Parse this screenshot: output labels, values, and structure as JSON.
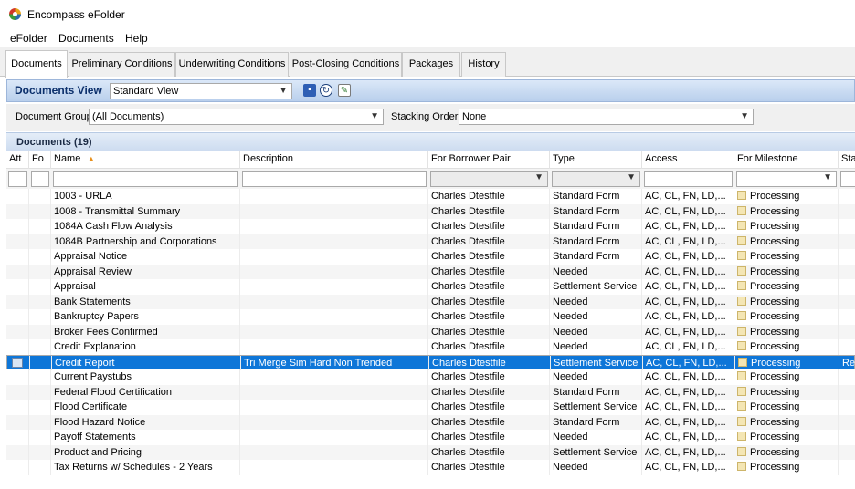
{
  "window": {
    "title": "Encompass eFolder"
  },
  "menu": [
    "eFolder",
    "Documents",
    "Help"
  ],
  "tabs": [
    "Documents",
    "Preliminary Conditions",
    "Underwriting Conditions",
    "Post-Closing Conditions",
    "Packages",
    "History"
  ],
  "documents_view": {
    "label": "Documents View",
    "view_value": "Standard View"
  },
  "filters": {
    "group_label": "Document Group",
    "group_value": "(All Documents)",
    "stacking_label": "Stacking Order",
    "stacking_value": "None"
  },
  "docs_header": "Documents (19)",
  "columns": [
    "Att",
    "Fo",
    "Name",
    "Description",
    "For Borrower Pair",
    "Type",
    "Access",
    "For Milestone",
    "Sta"
  ],
  "sort_indicator": "▲",
  "rows": [
    {
      "name": "1003 - URLA",
      "description": "",
      "borrower": "Charles Dtestfile",
      "type": "Standard Form",
      "access": "AC, CL, FN, LD,...",
      "milestone": "Processing",
      "status": ""
    },
    {
      "name": "1008 - Transmittal Summary",
      "description": "",
      "borrower": "Charles Dtestfile",
      "type": "Standard Form",
      "access": "AC, CL, FN, LD,...",
      "milestone": "Processing",
      "status": ""
    },
    {
      "name": "1084A Cash Flow Analysis",
      "description": "",
      "borrower": "Charles Dtestfile",
      "type": "Standard Form",
      "access": "AC, CL, FN, LD,...",
      "milestone": "Processing",
      "status": ""
    },
    {
      "name": "1084B Partnership and Corporations",
      "description": "",
      "borrower": "Charles Dtestfile",
      "type": "Standard Form",
      "access": "AC, CL, FN, LD,...",
      "milestone": "Processing",
      "status": ""
    },
    {
      "name": "Appraisal Notice",
      "description": "",
      "borrower": "Charles Dtestfile",
      "type": "Standard Form",
      "access": "AC, CL, FN, LD,...",
      "milestone": "Processing",
      "status": ""
    },
    {
      "name": "Appraisal Review",
      "description": "",
      "borrower": "Charles Dtestfile",
      "type": "Needed",
      "access": "AC, CL, FN, LD,...",
      "milestone": "Processing",
      "status": ""
    },
    {
      "name": "Appraisal",
      "description": "",
      "borrower": "Charles Dtestfile",
      "type": "Settlement Service",
      "access": "AC, CL, FN, LD,...",
      "milestone": "Processing",
      "status": ""
    },
    {
      "name": "Bank Statements",
      "description": "",
      "borrower": "Charles Dtestfile",
      "type": "Needed",
      "access": "AC, CL, FN, LD,...",
      "milestone": "Processing",
      "status": ""
    },
    {
      "name": "Bankruptcy Papers",
      "description": "",
      "borrower": "Charles Dtestfile",
      "type": "Needed",
      "access": "AC, CL, FN, LD,...",
      "milestone": "Processing",
      "status": ""
    },
    {
      "name": "Broker Fees Confirmed",
      "description": "",
      "borrower": "Charles Dtestfile",
      "type": "Needed",
      "access": "AC, CL, FN, LD,...",
      "milestone": "Processing",
      "status": ""
    },
    {
      "name": "Credit Explanation",
      "description": "",
      "borrower": "Charles Dtestfile",
      "type": "Needed",
      "access": "AC, CL, FN, LD,...",
      "milestone": "Processing",
      "status": ""
    },
    {
      "name": "Credit Report",
      "description": "Tri Merge Sim Hard Non Trended",
      "borrower": "Charles Dtestfile",
      "type": "Settlement Service",
      "access": "AC, CL, FN, LD,...",
      "milestone": "Processing",
      "status": "Rec",
      "selected": true,
      "attachment": true
    },
    {
      "name": "Current Paystubs",
      "description": "",
      "borrower": "Charles Dtestfile",
      "type": "Needed",
      "access": "AC, CL, FN, LD,...",
      "milestone": "Processing",
      "status": ""
    },
    {
      "name": "Federal Flood Certification",
      "description": "",
      "borrower": "Charles Dtestfile",
      "type": "Standard Form",
      "access": "AC, CL, FN, LD,...",
      "milestone": "Processing",
      "status": ""
    },
    {
      "name": "Flood Certificate",
      "description": "",
      "borrower": "Charles Dtestfile",
      "type": "Settlement Service",
      "access": "AC, CL, FN, LD,...",
      "milestone": "Processing",
      "status": ""
    },
    {
      "name": "Flood Hazard Notice",
      "description": "",
      "borrower": "Charles Dtestfile",
      "type": "Standard Form",
      "access": "AC, CL, FN, LD,...",
      "milestone": "Processing",
      "status": ""
    },
    {
      "name": "Payoff Statements",
      "description": "",
      "borrower": "Charles Dtestfile",
      "type": "Needed",
      "access": "AC, CL, FN, LD,...",
      "milestone": "Processing",
      "status": ""
    },
    {
      "name": "Product and Pricing",
      "description": "",
      "borrower": "Charles Dtestfile",
      "type": "Settlement Service",
      "access": "AC, CL, FN, LD,...",
      "milestone": "Processing",
      "status": ""
    },
    {
      "name": "Tax Returns w/ Schedules - 2 Years",
      "description": "",
      "borrower": "Charles Dtestfile",
      "type": "Needed",
      "access": "AC, CL, FN, LD,...",
      "milestone": "Processing",
      "status": ""
    }
  ]
}
